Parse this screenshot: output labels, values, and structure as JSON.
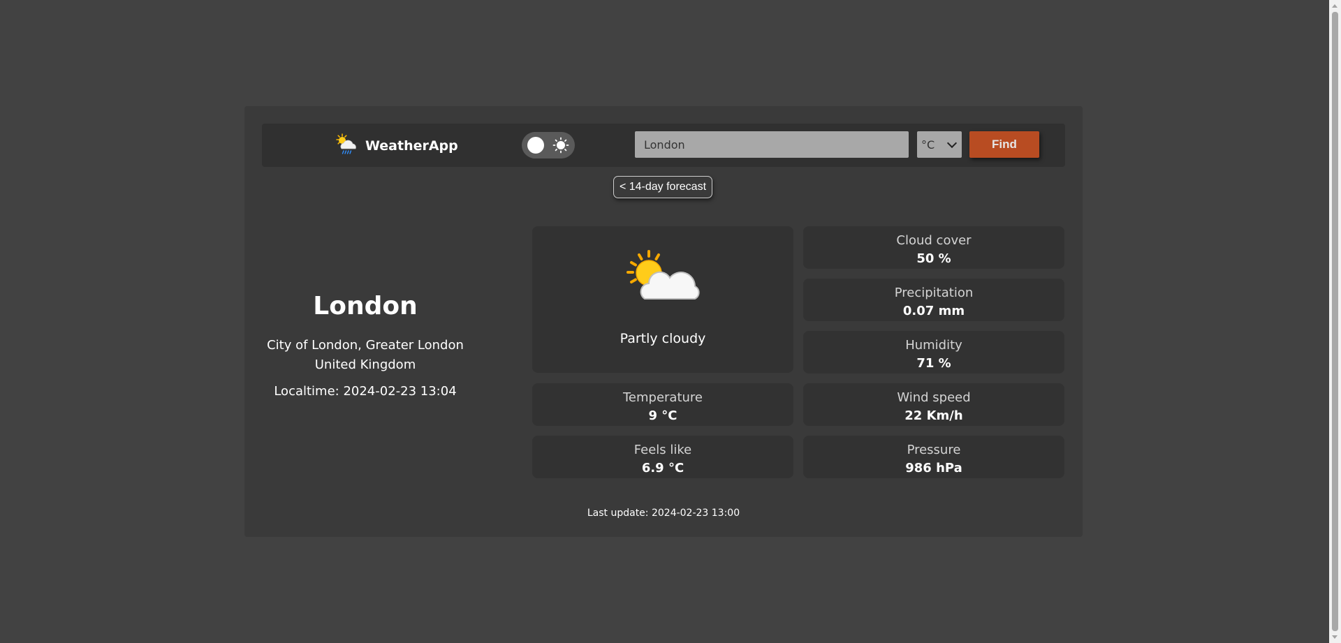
{
  "header": {
    "app_name": "WeatherApp",
    "search_value": "London",
    "unit_selected": "°C",
    "find_label": "Find",
    "forecast_link": "< 14-day forecast"
  },
  "location": {
    "city": "London",
    "region": "City of London, Greater London",
    "country": "United Kingdom",
    "localtime": "Localtime: 2024-02-23 13:04"
  },
  "current": {
    "condition": "Partly cloudy",
    "condition_icon": "partly-cloudy-icon",
    "cloud_cover": {
      "label": "Cloud cover",
      "value": "50 %"
    },
    "precipitation": {
      "label": "Precipitation",
      "value": "0.07 mm"
    },
    "humidity": {
      "label": "Humidity",
      "value": "71 %"
    },
    "temperature": {
      "label": "Temperature",
      "value": "9 °C"
    },
    "wind_speed": {
      "label": "Wind speed",
      "value": "22 Km/h"
    },
    "feels_like": {
      "label": "Feels like",
      "value": "6.9 °C"
    },
    "pressure": {
      "label": "Pressure",
      "value": "986 hPa"
    }
  },
  "footer": {
    "last_update": "Last update: 2024-02-23 13:00"
  },
  "colors": {
    "page_bg": "#424242",
    "card_bg": "#3a3a3a",
    "tile_bg": "#323232",
    "accent": "#b84c22"
  }
}
